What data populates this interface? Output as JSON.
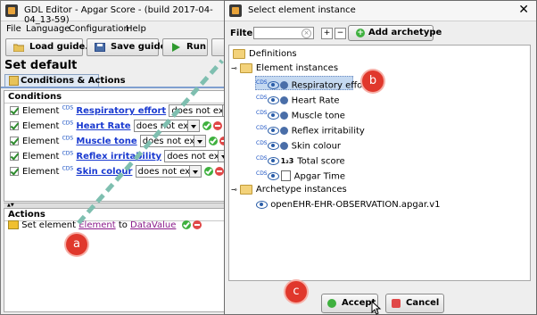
{
  "main": {
    "title": "GDL Editor - Apgar Score - (build 2017-04-04_13-59)",
    "menu": [
      "File",
      "Language",
      "Configuration",
      "Help"
    ],
    "toolbar": {
      "load": "Load guide...",
      "save": "Save guide",
      "run": "Run"
    },
    "heading": "Set default",
    "tab": "Conditions & Actions",
    "conditions_label": "Conditions",
    "conditions": [
      {
        "prefix": "Element",
        "cds": "CDS",
        "name": "Respiratory effort",
        "op": "does not exist"
      },
      {
        "prefix": "Element",
        "cds": "CDS",
        "name": "Heart Rate",
        "op": "does not exist"
      },
      {
        "prefix": "Element",
        "cds": "CDS",
        "name": "Muscle tone",
        "op": "does not exist"
      },
      {
        "prefix": "Element",
        "cds": "CDS",
        "name": "Reflex irritability",
        "op": "does not exist"
      },
      {
        "prefix": "Element",
        "cds": "CDS",
        "name": "Skin colour",
        "op": "does not exist"
      }
    ],
    "actions_label": "Actions",
    "action": {
      "prefix": "Set element",
      "element": "Element",
      "to": "to",
      "value": "DataValue"
    }
  },
  "dialog": {
    "title": "Select element instance",
    "filter_label": "Filter :",
    "filter_value": "",
    "add_archetype": "Add archetype",
    "root": "Definitions",
    "element_instances": "Element instances",
    "elements": [
      {
        "cds": "CDS",
        "name": "Respiratory effort",
        "icon": "record-icon"
      },
      {
        "cds": "CDS",
        "name": "Heart Rate",
        "icon": "record-icon"
      },
      {
        "cds": "CDS",
        "name": "Muscle tone",
        "icon": "record-icon"
      },
      {
        "cds": "CDS",
        "name": "Reflex irritability",
        "icon": "record-icon"
      },
      {
        "cds": "CDS",
        "name": "Skin colour",
        "icon": "record-icon"
      },
      {
        "cds": "CDS",
        "name": "Total score",
        "icon": "count-icon",
        "glyph": "1₂3"
      },
      {
        "cds": "CDS",
        "name": "Apgar Time",
        "icon": "date-time-icon"
      }
    ],
    "archetype_instances": "Archetype instances",
    "archetype": "openEHR-EHR-OBSERVATION.apgar.v1",
    "accept": "Accept",
    "cancel": "Cancel"
  },
  "callouts": {
    "a": "a",
    "b": "b",
    "c": "c"
  },
  "colors": {
    "callout": "#e0382c",
    "link": "#1a3ad0",
    "selection": "#c5d9f1",
    "dashed_arrow": "#7fbfb0"
  }
}
